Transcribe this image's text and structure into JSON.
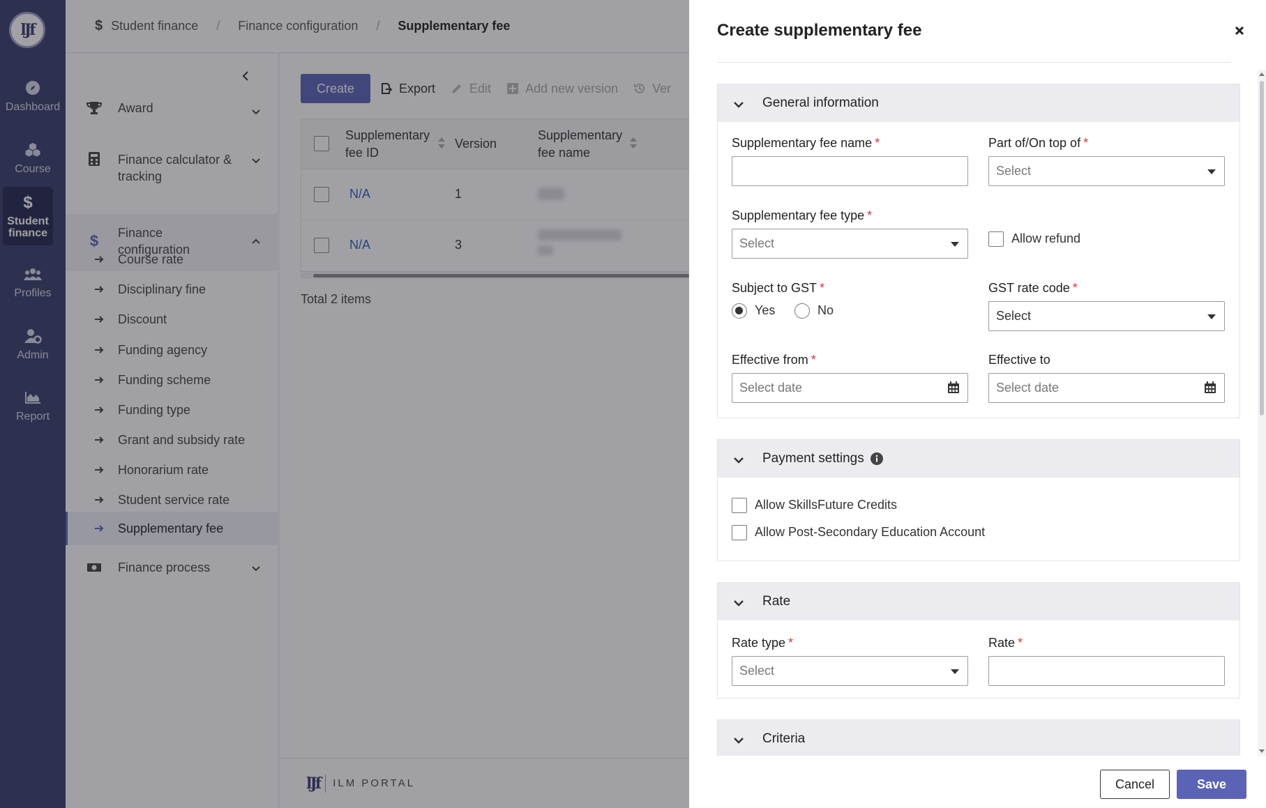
{
  "rail": {
    "items": [
      {
        "label": "Dashboard",
        "icon": "compass-icon"
      },
      {
        "label": "Course",
        "icon": "cubes-icon"
      },
      {
        "label": "Student finance",
        "icon": "dollar-icon"
      },
      {
        "label": "Profiles",
        "icon": "users-icon"
      },
      {
        "label": "Admin",
        "icon": "user-cog-icon"
      },
      {
        "label": "Report",
        "icon": "area-chart-icon"
      }
    ],
    "active": "Student finance"
  },
  "breadcrumb": [
    "Student finance",
    "Finance configuration",
    "Supplementary fee"
  ],
  "sidebar": {
    "groups": [
      {
        "label": "Award",
        "icon": "trophy-icon"
      },
      {
        "label": "Finance calculator & tracking",
        "icon": "calculator-icon"
      },
      {
        "label": "Finance configuration",
        "icon": "dollar-icon"
      },
      {
        "label": "Finance process",
        "icon": "money-icon"
      }
    ],
    "subitems": [
      "Course rate",
      "Disciplinary fine",
      "Discount",
      "Funding agency",
      "Funding scheme",
      "Funding type",
      "Grant and subsidy rate",
      "Honorarium rate",
      "Student service rate",
      "Supplementary fee"
    ],
    "active_subitem": "Supplementary fee"
  },
  "toolbar": {
    "create": "Create",
    "export": "Export",
    "edit": "Edit",
    "add_version": "Add new version",
    "version_history": "Ver"
  },
  "table": {
    "columns": [
      "Supplementary fee ID",
      "Version",
      "Supplementary fee name"
    ],
    "rows": [
      {
        "id": "N/A",
        "version": "1"
      },
      {
        "id": "N/A",
        "version": "3"
      }
    ],
    "total": "Total 2 items"
  },
  "footer": {
    "brand": "ILM PORTAL"
  },
  "drawer": {
    "title": "Create supplementary fee",
    "sections": {
      "general": {
        "title": "General information",
        "fee_name_label": "Supplementary fee name",
        "fee_name_value": "",
        "part_of_label": "Part of/On top of",
        "part_of_value": "Select",
        "fee_type_label": "Supplementary fee type",
        "fee_type_value": "Select",
        "allow_refund_label": "Allow refund",
        "allow_refund": false,
        "gst_label": "Subject to GST",
        "gst_yes": "Yes",
        "gst_no": "No",
        "gst_selected": "Yes",
        "gst_rate_label": "GST rate code",
        "gst_rate_value": "Select",
        "effective_from_label": "Effective from",
        "effective_from_placeholder": "Select date",
        "effective_to_label": "Effective to",
        "effective_to_placeholder": "Select date"
      },
      "payment": {
        "title": "Payment settings",
        "skillsfuture_label": "Allow SkillsFuture Credits",
        "skillsfuture": false,
        "pse_label": "Allow Post-Secondary Education Account",
        "pse": false
      },
      "rate": {
        "title": "Rate",
        "rate_type_label": "Rate type",
        "rate_type_value": "Select",
        "rate_label": "Rate",
        "rate_value": ""
      },
      "criteria": {
        "title": "Criteria"
      }
    },
    "required_mark": "*",
    "cancel": "Cancel",
    "save": "Save"
  },
  "colors": {
    "rail": "#3a3d6b",
    "accent": "#5b63b7",
    "link": "#2b5fb5",
    "required": "#d9333f"
  }
}
